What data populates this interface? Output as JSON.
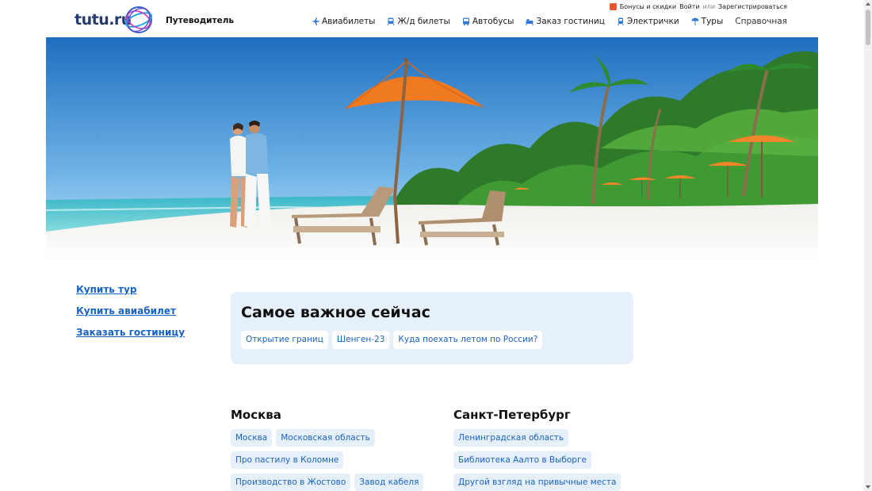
{
  "header": {
    "logo_text": "tutu.ru",
    "section_title": "Путеводитель",
    "auth": {
      "bonuses": "Бонусы и скидки",
      "login": "Войти",
      "or": "или",
      "register": "Зарегистрироваться"
    },
    "nav": [
      {
        "label": "Авиабилеты",
        "icon": "plane-icon"
      },
      {
        "label": "Ж/д билеты",
        "icon": "train-icon"
      },
      {
        "label": "Автобусы",
        "icon": "bus-icon"
      },
      {
        "label": "Заказ гостиниц",
        "icon": "hotel-icon"
      },
      {
        "label": "Электрички",
        "icon": "suburban-train-icon"
      },
      {
        "label": "Туры",
        "icon": "tours-icon"
      },
      {
        "label": "Справочная",
        "icon": ""
      }
    ]
  },
  "side_links": [
    "Купить тур",
    "Купить авиабилет",
    "Заказать гостиницу"
  ],
  "important": {
    "title": "Самое важное сейчас",
    "chips": [
      "Открытие границ",
      "Шенген-23",
      "Куда поехать летом по России?"
    ]
  },
  "cities": [
    {
      "name": "Москва",
      "rows": [
        [
          "Москва",
          "Московская область"
        ],
        [
          "Про пастилу в Коломне"
        ],
        [
          "Производство в Жостово",
          "Завод кабеля"
        ]
      ]
    },
    {
      "name": "Санкт-Петербург",
      "rows": [
        [
          "Ленинградская область"
        ],
        [
          "Библиотека Аалто в Выборге"
        ],
        [
          "Другой взгляд на привычные места"
        ]
      ]
    }
  ],
  "colors": {
    "link": "#1763c6",
    "chip_bg": "#e6f0fb",
    "logo": "#243b6b"
  }
}
